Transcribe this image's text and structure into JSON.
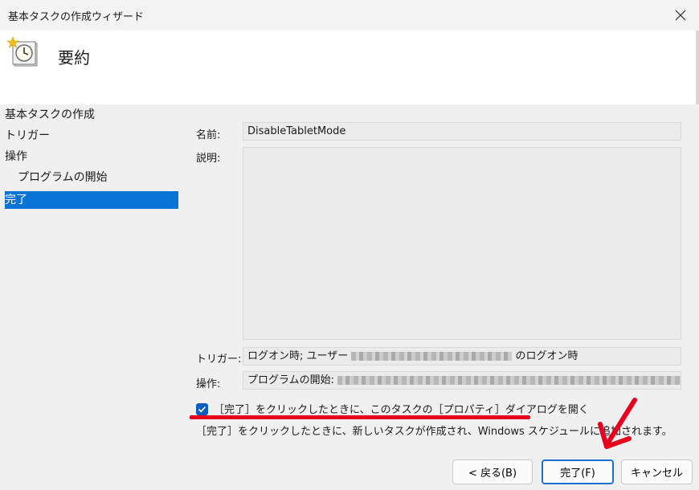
{
  "window": {
    "title": "基本タスクの作成ウィザード"
  },
  "header": {
    "title": "要約"
  },
  "sidebar": {
    "items": [
      {
        "label": "基本タスクの作成"
      },
      {
        "label": "トリガー"
      },
      {
        "label": "操作"
      },
      {
        "label": "プログラムの開始"
      },
      {
        "label": "完了"
      }
    ]
  },
  "summary": {
    "name_label": "名前:",
    "name_value": "DisableTabletMode",
    "description_label": "説明:",
    "description_value": "",
    "trigger_label": "トリガー:",
    "trigger_prefix": "ログオン時; ユーザー",
    "trigger_suffix": "のログオン時",
    "action_label": "操作:",
    "action_prefix": "プログラムの開始:"
  },
  "options": {
    "open_properties_label": "［完了］をクリックしたときに、このタスクの［プロパティ］ダイアログを開く",
    "open_properties_checked": true,
    "hint": "［完了］をクリックしたときに、新しいタスクが作成され、Windows スケジュールに追加されます。"
  },
  "buttons": {
    "back": "< 戻る(B)",
    "finish": "完了(F)",
    "cancel": "キャンセル"
  },
  "colors": {
    "accent": "#0a74d6",
    "annotation": "#e8001c"
  }
}
